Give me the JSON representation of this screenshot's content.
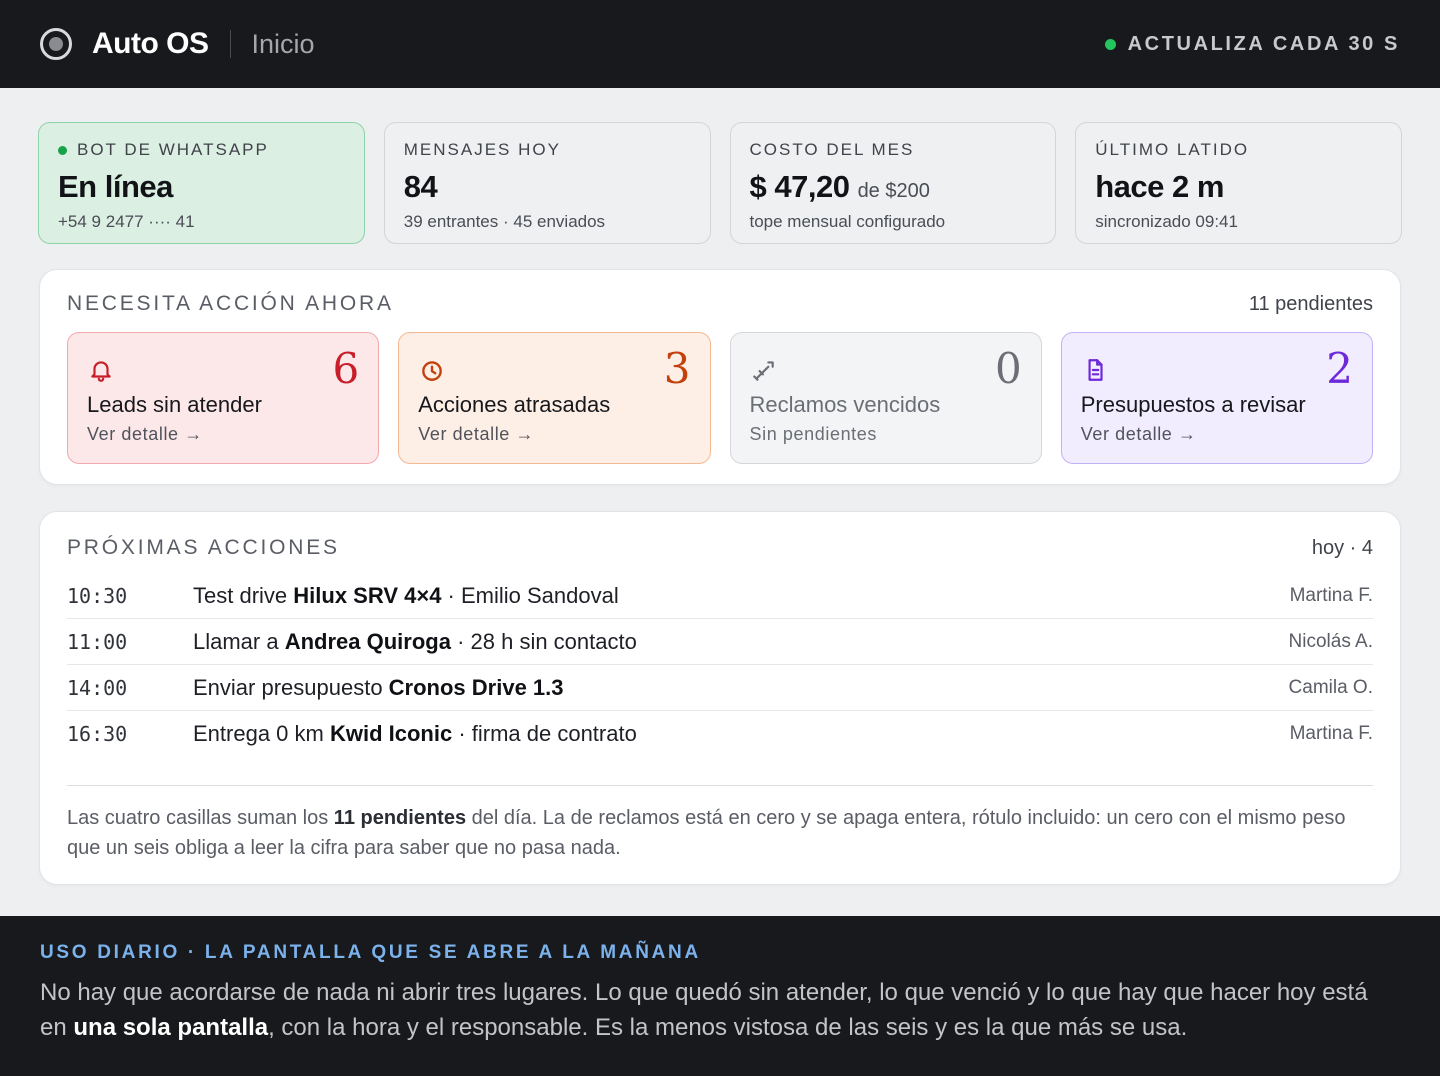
{
  "header": {
    "app_title": "Auto OS",
    "page": "Inicio",
    "refresh_label": "ACTUALIZA CADA 30 S",
    "status_color": "#22c55e"
  },
  "stats": [
    {
      "label": "BOT DE WHATSAPP",
      "value": "En línea",
      "value_suffix": "",
      "sub": "+54 9 2477 ···· 41",
      "status": "online",
      "status_color": "#16a34a"
    },
    {
      "label": "MENSAJES HOY",
      "value": "84",
      "value_suffix": "",
      "sub": "39 entrantes · 45 enviados"
    },
    {
      "label": "COSTO DEL MES",
      "value": "$ 47,20",
      "value_suffix": "de $200",
      "sub": "tope mensual configurado"
    },
    {
      "label": "ÚLTIMO LATIDO",
      "value": "hace 2 m",
      "value_suffix": "",
      "sub": "sincronizado 09:41"
    }
  ],
  "action_section": {
    "title": "NECESITA ACCIÓN AHORA",
    "meta": "11 pendientes",
    "tiles": [
      {
        "icon": "bell-icon",
        "count": "6",
        "name": "Leads sin atender",
        "link": "Ver detalle →",
        "accent": "#c81e2a"
      },
      {
        "icon": "clock-icon",
        "count": "3",
        "name": "Acciones atrasadas",
        "link": "Ver detalle →",
        "accent": "#c2410c"
      },
      {
        "icon": "wrench-icon",
        "count": "0",
        "name": "Reclamos vencidos",
        "link": "Sin pendientes",
        "accent": "#6b6e75"
      },
      {
        "icon": "document-icon",
        "count": "2",
        "name": "Presupuestos a revisar",
        "link": "Ver detalle →",
        "accent": "#6d28d9"
      }
    ]
  },
  "next_section": {
    "title": "PRÓXIMAS ACCIONES",
    "meta": "hoy · 4",
    "rows": [
      {
        "time": "10:30",
        "pre": "Test drive ",
        "bold": "Hilux SRV 4×4",
        "post": " · Emilio Sandoval",
        "owner": "Martina F."
      },
      {
        "time": "11:00",
        "pre": "Llamar a ",
        "bold": "Andrea Quiroga",
        "post": " · 28 h sin contacto",
        "owner": "Nicolás A."
      },
      {
        "time": "14:00",
        "pre": "Enviar presupuesto ",
        "bold": "Cronos Drive 1.3",
        "post": "",
        "owner": "Camila O."
      },
      {
        "time": "16:30",
        "pre": "Entrega 0 km ",
        "bold": "Kwid Iconic",
        "post": " · firma de contrato",
        "owner": "Martina F."
      }
    ],
    "note_pre": "Las cuatro casillas suman los ",
    "note_bold": "11 pendientes",
    "note_post": " del día. La de reclamos está en cero y se apaga entera, rótulo incluido: un cero con el mismo peso que un seis obliga a leer la cifra para saber que no pasa nada."
  },
  "footer": {
    "eyebrow": "USO DIARIO · LA PANTALLA QUE SE ABRE A LA MAÑANA",
    "text_pre": "No hay que acordarse de nada ni abrir tres lugares. Lo que quedó sin atender, lo que venció y lo que hay que hacer hoy está en ",
    "text_bold": "una sola pantalla",
    "text_post": ", con la hora y el responsable. Es la menos vistosa de las seis y es la que más se usa."
  }
}
